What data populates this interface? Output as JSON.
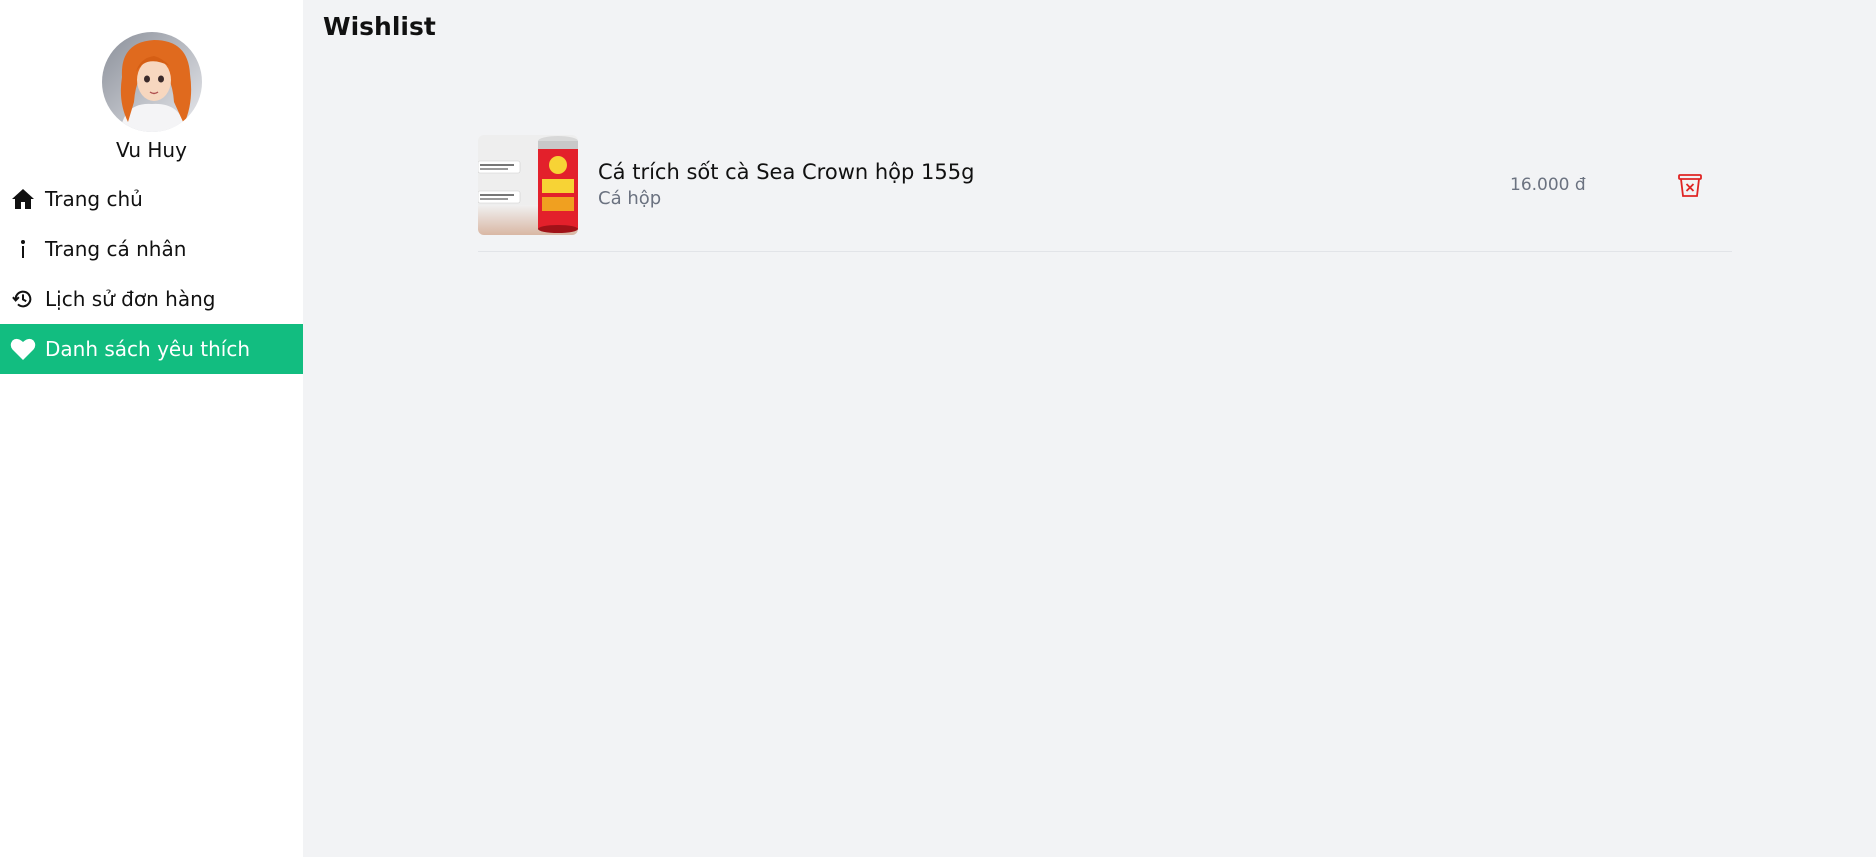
{
  "user": {
    "name": "Vu Huy"
  },
  "sidebar": {
    "items": [
      {
        "label": "Trang chủ",
        "icon": "home-icon",
        "active": false
      },
      {
        "label": "Trang cá nhân",
        "icon": "info-icon",
        "active": false
      },
      {
        "label": "Lịch sử đơn hàng",
        "icon": "history-icon",
        "active": false
      },
      {
        "label": "Danh sách yêu thích",
        "icon": "heart-icon",
        "active": true
      }
    ]
  },
  "page": {
    "title": "Wishlist"
  },
  "wishlist": {
    "items": [
      {
        "name": "Cá trích sốt cà Sea Crown hộp 155g",
        "category": "Cá hộp",
        "price": "16.000 đ",
        "delete_icon": "trash-icon"
      }
    ]
  },
  "colors": {
    "accent": "#12bd80",
    "delete": "#e02424",
    "muted_text": "#6b7280"
  }
}
